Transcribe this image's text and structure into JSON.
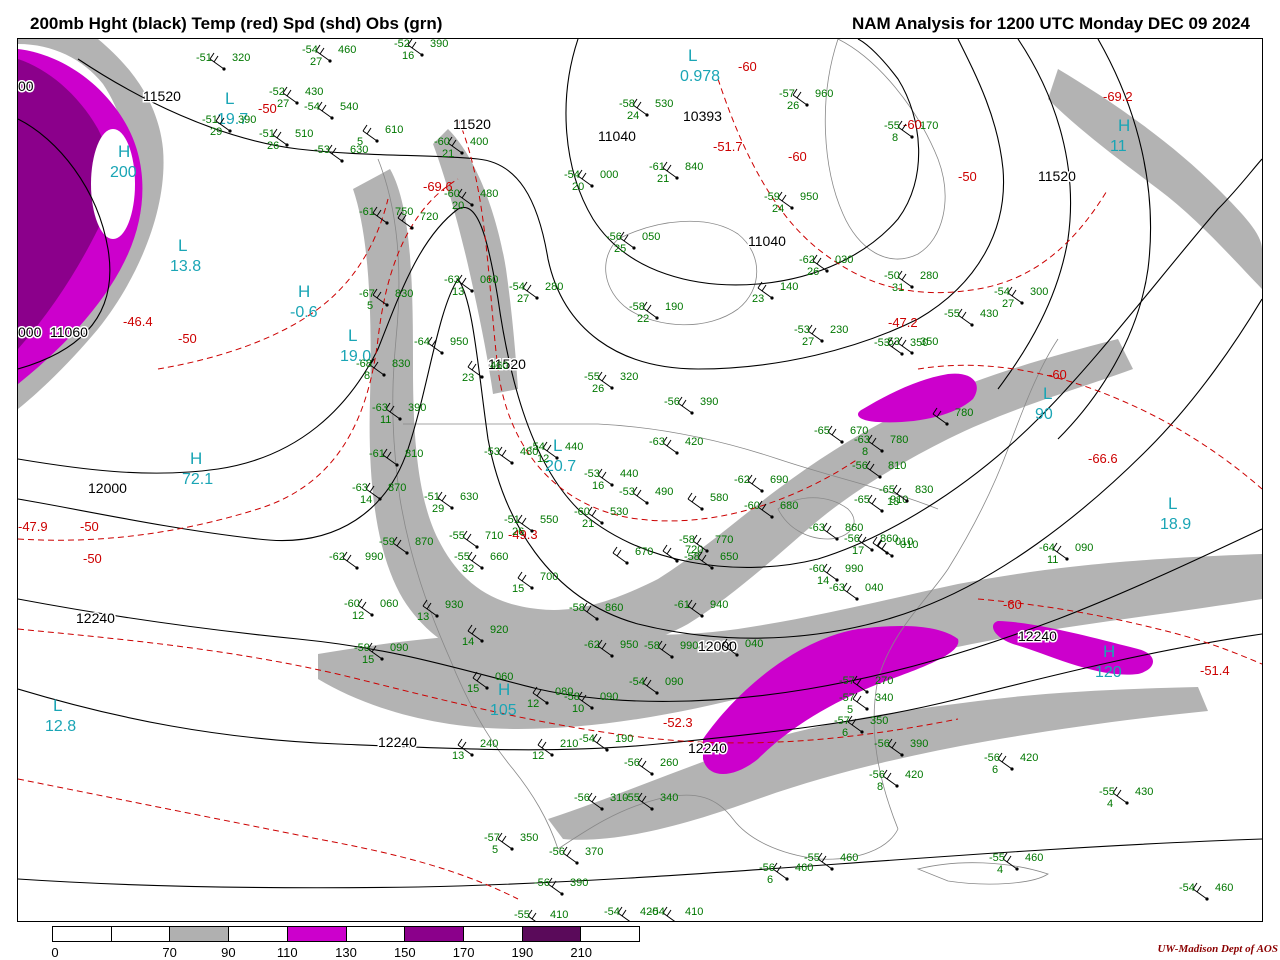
{
  "header": {
    "left_title": "200mb Hght (black) Temp (red) Spd (shd) Obs (grn)",
    "right_title": "NAM Analysis for 1200 UTC Monday  DEC 09 2024"
  },
  "colors": {
    "height_contours": "#000000",
    "temperature_contours": "#cc0000",
    "observations": "#007700",
    "centers": "#1aa5b5",
    "temp_labels": "#cc0000",
    "geography": "#888888"
  },
  "colorbar": {
    "labels": [
      "0",
      "70",
      "90",
      "110",
      "130",
      "150",
      "170",
      "190",
      "210"
    ],
    "segment_colors": [
      "#ffffff",
      "#ffffff",
      "#b0b0b0",
      "#ffffff",
      "#cc00cc",
      "#ffffff",
      "#8b008b",
      "#ffffff",
      "#5a0a5a",
      "#ffffff"
    ]
  },
  "credit": "UW-Madison   Dept of AOS",
  "height_labels": [
    "11520",
    "11520",
    "11040",
    "11040",
    "11520",
    "10393",
    "11520",
    "12000",
    "12240",
    "12000",
    "12240",
    "12240",
    "12240",
    "11060",
    "000",
    "00"
  ],
  "temperature_labels": [
    "-46.4",
    "-50",
    "-69.6",
    "-50",
    "-60",
    "-60",
    "-69.2",
    "-47.2",
    "-60",
    "-66.6",
    "-49.3",
    "-47.9",
    "-50",
    "-50",
    "-52.3",
    "-60",
    "-51.4",
    "-60",
    "-51.7",
    "-50"
  ],
  "centers": [
    {
      "letter": "L",
      "value": "19.7"
    },
    {
      "letter": "L",
      "value": "13.8"
    },
    {
      "letter": "H",
      "value": "-0.6"
    },
    {
      "letter": "L",
      "value": "19.0"
    },
    {
      "letter": "H",
      "value": "72.1"
    },
    {
      "letter": "L",
      "value": "12.8"
    },
    {
      "letter": "L",
      "value": "0.978"
    },
    {
      "letter": "L",
      "value": "20.7"
    },
    {
      "letter": "H",
      "value": "11"
    },
    {
      "letter": "L",
      "value": "18.9"
    },
    {
      "letter": "H",
      "value": "200"
    },
    {
      "letter": "H",
      "value": "105"
    },
    {
      "letter": "H",
      "value": "120"
    },
    {
      "letter": "L",
      "value": "90"
    }
  ],
  "observations": [
    {
      "t": "-54",
      "h": "460",
      "d": "27"
    },
    {
      "t": "-52",
      "h": "390",
      "d": "16"
    },
    {
      "t": "-51",
      "h": "320",
      "d": ""
    },
    {
      "t": "-52",
      "h": "430",
      "d": "27"
    },
    {
      "t": "-51",
      "h": "390",
      "d": "29"
    },
    {
      "t": "-54",
      "h": "540",
      "d": ""
    },
    {
      "t": "",
      "h": "610",
      "d": "5"
    },
    {
      "t": "-51",
      "h": "510",
      "d": "26"
    },
    {
      "t": "-53",
      "h": "630",
      "d": ""
    },
    {
      "t": "-60",
      "h": "400",
      "d": "21"
    },
    {
      "t": "-61",
      "h": "750",
      "d": ""
    },
    {
      "t": "",
      "h": "720",
      "d": ""
    },
    {
      "t": "-60",
      "h": "480",
      "d": "20"
    },
    {
      "t": "-54",
      "h": "280",
      "d": "27"
    },
    {
      "t": "-58",
      "h": "530",
      "d": "24"
    },
    {
      "t": "-54",
      "h": "000",
      "d": "20"
    },
    {
      "t": "-56",
      "h": "050",
      "d": "25"
    },
    {
      "t": "-61",
      "h": "840",
      "d": "21"
    },
    {
      "t": "-59",
      "h": "950",
      "d": "24"
    },
    {
      "t": "-57",
      "h": "960",
      "d": "26"
    },
    {
      "t": "-55",
      "h": "170",
      "d": "8"
    },
    {
      "t": "-62",
      "h": "030",
      "d": "26"
    },
    {
      "t": "-50",
      "h": "280",
      "d": "31"
    },
    {
      "t": "-54",
      "h": "300",
      "d": "27"
    },
    {
      "t": "-55",
      "h": "430",
      "d": ""
    },
    {
      "t": "-53",
      "h": "230",
      "d": "27"
    },
    {
      "t": "",
      "h": "140",
      "d": "23"
    },
    {
      "t": "-58",
      "h": "190",
      "d": "22"
    },
    {
      "t": "-63",
      "h": "060",
      "d": "13"
    },
    {
      "t": "-67",
      "h": "830",
      "d": "5"
    },
    {
      "t": "-64",
      "h": "950",
      "d": ""
    },
    {
      "t": "-68",
      "h": "830",
      "d": "8"
    },
    {
      "t": "",
      "h": "460",
      "d": "23"
    },
    {
      "t": "-55",
      "h": "320",
      "d": "26"
    },
    {
      "t": "-53",
      "h": "350",
      "d": ""
    },
    {
      "t": "-56",
      "h": "390",
      "d": ""
    },
    {
      "t": "-63",
      "h": "420",
      "d": ""
    },
    {
      "t": "-63",
      "h": "390",
      "d": "11"
    },
    {
      "t": "-53",
      "h": "480",
      "d": ""
    },
    {
      "t": "-54",
      "h": "440",
      "d": "12"
    },
    {
      "t": "-53",
      "h": "440",
      "d": "16"
    },
    {
      "t": "-61",
      "h": "810",
      "d": ""
    },
    {
      "t": "-63",
      "h": "870",
      "d": "14"
    },
    {
      "t": "-51",
      "h": "630",
      "d": "29"
    },
    {
      "t": "-53",
      "h": "490",
      "d": ""
    },
    {
      "t": "",
      "h": "580",
      "d": ""
    },
    {
      "t": "-51",
      "h": "550",
      "d": "26"
    },
    {
      "t": "-60",
      "h": "530",
      "d": "21"
    },
    {
      "t": "-55",
      "h": "710",
      "d": ""
    },
    {
      "t": "-55",
      "h": "660",
      "d": "32"
    },
    {
      "t": "-59",
      "h": "870",
      "d": ""
    },
    {
      "t": "-62",
      "h": "990",
      "d": ""
    },
    {
      "t": "",
      "h": "700",
      "d": "15"
    },
    {
      "t": "",
      "h": "670",
      "d": ""
    },
    {
      "t": "",
      "h": "720",
      "d": ""
    },
    {
      "t": "-58",
      "h": "770",
      "d": ""
    },
    {
      "t": "-58",
      "h": "650",
      "d": ""
    },
    {
      "t": "-60",
      "h": "060",
      "d": "12"
    },
    {
      "t": "",
      "h": "930",
      "d": "13"
    },
    {
      "t": "",
      "h": "920",
      "d": "14"
    },
    {
      "t": "-58",
      "h": "860",
      "d": ""
    },
    {
      "t": "-61",
      "h": "940",
      "d": ""
    },
    {
      "t": "-59",
      "h": "090",
      "d": "15"
    },
    {
      "t": "-62",
      "h": "950",
      "d": ""
    },
    {
      "t": "-58",
      "h": "990",
      "d": ""
    },
    {
      "t": "",
      "h": "040",
      "d": ""
    },
    {
      "t": "",
      "h": "060",
      "d": "15"
    },
    {
      "t": "",
      "h": "080",
      "d": "12"
    },
    {
      "t": "-58",
      "h": "090",
      "d": "10"
    },
    {
      "t": "-54",
      "h": "090",
      "d": ""
    },
    {
      "t": "",
      "h": "240",
      "d": "13"
    },
    {
      "t": "",
      "h": "210",
      "d": "12"
    },
    {
      "t": "-54",
      "h": "190",
      "d": ""
    },
    {
      "t": "-56",
      "h": "260",
      "d": ""
    },
    {
      "t": "-56",
      "h": "310",
      "d": ""
    },
    {
      "t": "-55",
      "h": "340",
      "d": ""
    },
    {
      "t": "-57",
      "h": "350",
      "d": "5"
    },
    {
      "t": "-56",
      "h": "370",
      "d": ""
    },
    {
      "t": "-56",
      "h": "390",
      "d": ""
    },
    {
      "t": "-55",
      "h": "410",
      "d": ""
    },
    {
      "t": "-54",
      "h": "420",
      "d": ""
    },
    {
      "t": "-54",
      "h": "410",
      "d": ""
    },
    {
      "t": "-56",
      "h": "460",
      "d": "6"
    },
    {
      "t": "-55",
      "h": "460",
      "d": ""
    },
    {
      "t": "-55",
      "h": "460",
      "d": "4"
    },
    {
      "t": "-54",
      "h": "460",
      "d": ""
    },
    {
      "t": "-56",
      "h": "420",
      "d": "6"
    },
    {
      "t": "-55",
      "h": "430",
      "d": "4"
    },
    {
      "t": "-56",
      "h": "420",
      "d": "8"
    },
    {
      "t": "-56",
      "h": "390",
      "d": ""
    },
    {
      "t": "-57",
      "h": "350",
      "d": "6"
    },
    {
      "t": "-57",
      "h": "340",
      "d": "5"
    },
    {
      "t": "-57",
      "h": "270",
      "d": ""
    },
    {
      "t": "-64",
      "h": "090",
      "d": "11"
    },
    {
      "t": "-63",
      "h": "040",
      "d": ""
    },
    {
      "t": "-60",
      "h": "990",
      "d": "14"
    },
    {
      "t": "",
      "h": "010",
      "d": ""
    },
    {
      "t": "-56",
      "h": "860",
      "d": "17"
    },
    {
      "t": "-63",
      "h": "860",
      "d": ""
    },
    {
      "t": "-65",
      "h": "910",
      "d": ""
    },
    {
      "t": "-65",
      "h": "830",
      "d": "13"
    },
    {
      "t": "-56",
      "h": "810",
      "d": ""
    },
    {
      "t": "-63",
      "h": "780",
      "d": "8"
    },
    {
      "t": "",
      "h": "780",
      "d": ""
    },
    {
      "t": "-65",
      "h": "670",
      "d": ""
    },
    {
      "t": "-62",
      "h": "690",
      "d": ""
    },
    {
      "t": "-60",
      "h": "680",
      "d": ""
    },
    {
      "t": "-53",
      "h": "350",
      "d": ""
    },
    {
      "t": "",
      "h": "010",
      "d": ""
    }
  ]
}
